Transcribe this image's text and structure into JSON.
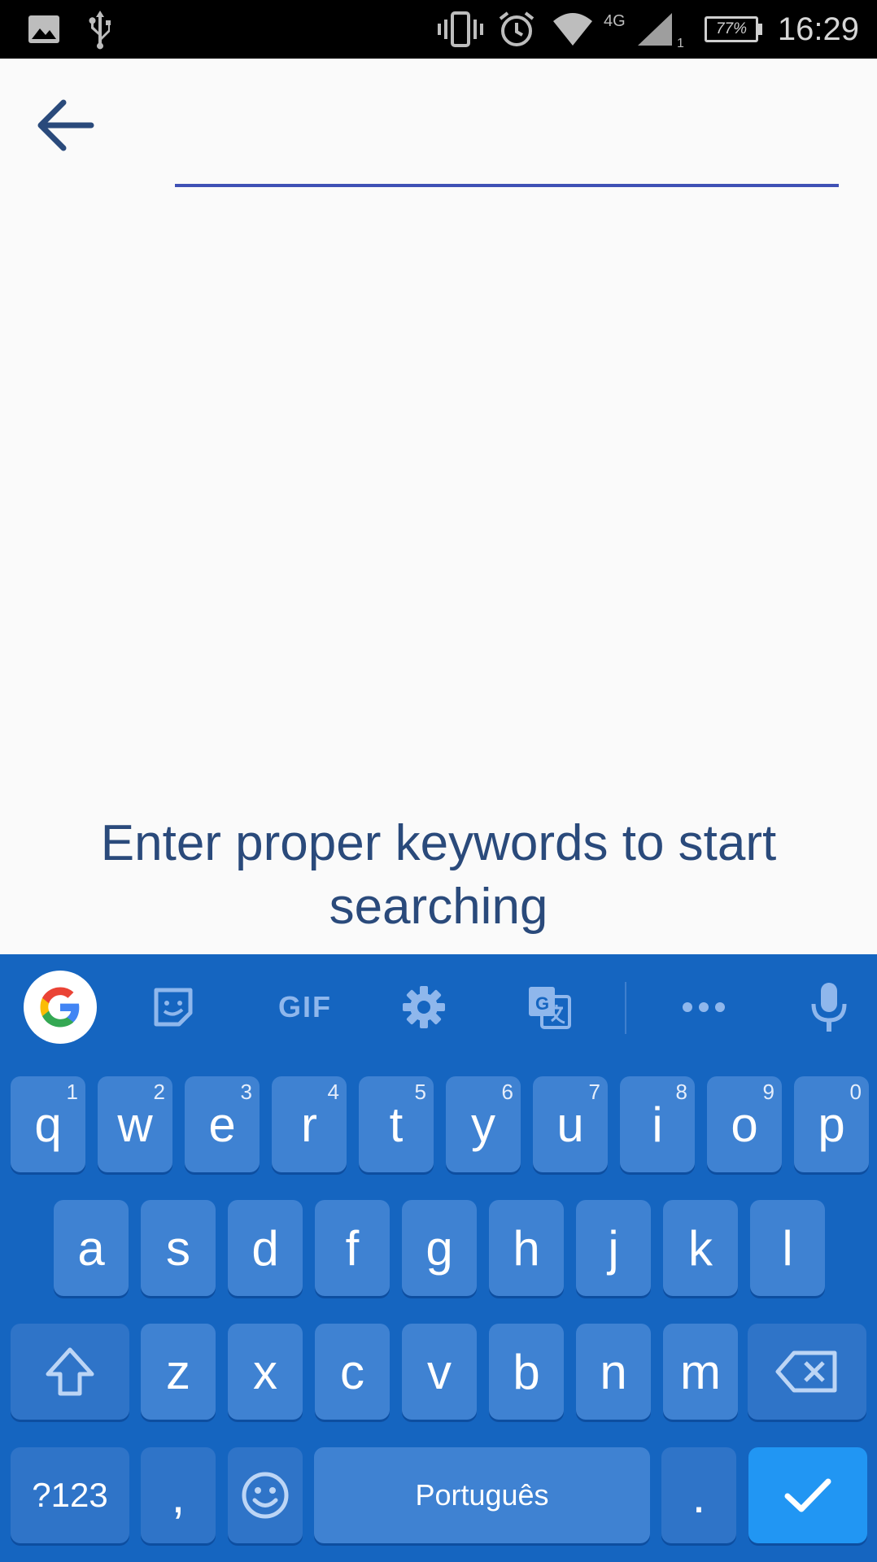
{
  "status_bar": {
    "time": "16:29",
    "battery": "77%",
    "network": "4G",
    "sim_slot": "1",
    "icons": [
      "image-icon",
      "usb-icon",
      "vibrate-icon",
      "alarm-icon",
      "wifi-icon",
      "signal-icon",
      "battery-icon"
    ]
  },
  "search": {
    "back_icon": "arrow-left-icon",
    "value": "",
    "placeholder": "",
    "accent_color": "#3f51b5"
  },
  "empty_state": {
    "message": "Enter proper keywords to start searching"
  },
  "keyboard": {
    "background": "#1565c0",
    "toolbar": {
      "google_icon": "google-g-icon",
      "sticker_icon": "sticker-icon",
      "gif_label": "GIF",
      "settings_icon": "gear-icon",
      "translate_icon": "translate-icon",
      "more_icon": "more-horizontal-icon",
      "mic_icon": "microphone-icon"
    },
    "row1": [
      {
        "label": "q",
        "hint": "1"
      },
      {
        "label": "w",
        "hint": "2"
      },
      {
        "label": "e",
        "hint": "3"
      },
      {
        "label": "r",
        "hint": "4"
      },
      {
        "label": "t",
        "hint": "5"
      },
      {
        "label": "y",
        "hint": "6"
      },
      {
        "label": "u",
        "hint": "7"
      },
      {
        "label": "i",
        "hint": "8"
      },
      {
        "label": "o",
        "hint": "9"
      },
      {
        "label": "p",
        "hint": "0"
      }
    ],
    "row2": [
      "a",
      "s",
      "d",
      "f",
      "g",
      "h",
      "j",
      "k",
      "l"
    ],
    "row3": [
      "z",
      "x",
      "c",
      "v",
      "b",
      "n",
      "m"
    ],
    "symbols_label": "?123",
    "comma_label": ",",
    "space_label": "Português",
    "period_label": ".",
    "shift_icon": "shift-icon",
    "backspace_icon": "backspace-icon",
    "emoji_icon": "emoji-icon",
    "enter_icon": "check-icon"
  }
}
